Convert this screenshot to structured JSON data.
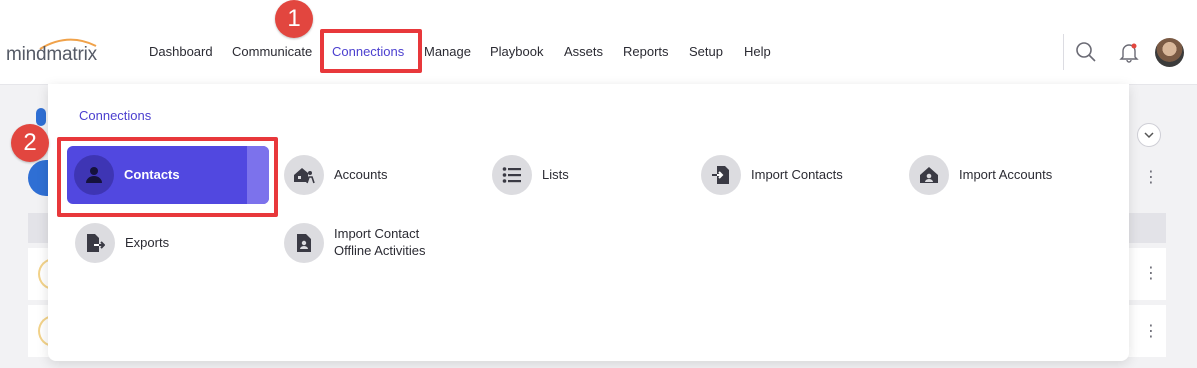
{
  "brand": {
    "logo_text": "mindmatrix"
  },
  "nav": {
    "items": [
      {
        "label": "Dashboard"
      },
      {
        "label": "Communicate"
      },
      {
        "label": "Connections"
      },
      {
        "label": "Manage"
      },
      {
        "label": "Playbook"
      },
      {
        "label": "Assets"
      },
      {
        "label": "Reports"
      },
      {
        "label": "Setup"
      },
      {
        "label": "Help"
      }
    ],
    "active": "Connections",
    "icons": [
      "search-icon",
      "bell-icon",
      "avatar"
    ]
  },
  "annotations": {
    "step1": "1",
    "step2": "2"
  },
  "dropdown": {
    "heading": "Connections",
    "items": [
      {
        "label": "Contacts",
        "icon": "person-icon",
        "selected": true
      },
      {
        "label": "Accounts",
        "icon": "account-house-person-icon"
      },
      {
        "label": "Lists",
        "icon": "list-icon"
      },
      {
        "label": "Import Contacts",
        "icon": "import-contacts-icon"
      },
      {
        "label": "Import Accounts",
        "icon": "import-accounts-icon"
      },
      {
        "label": "Exports",
        "icon": "export-file-icon"
      },
      {
        "label_line1": "Import Contact",
        "label_line2": "Offline Activities",
        "icon": "contact-file-icon"
      }
    ]
  },
  "colors": {
    "accent": "#4b3fcf",
    "selected_bg": "#5148e0",
    "highlight": "#e8383b"
  }
}
